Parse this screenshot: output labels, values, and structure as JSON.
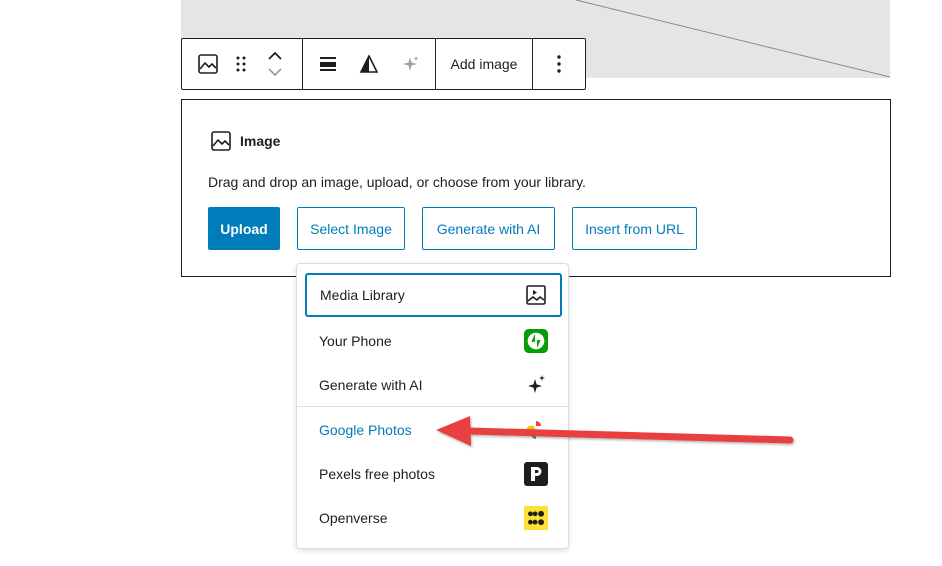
{
  "toolbar": {
    "add_image_label": "Add image",
    "icons": [
      "image-icon",
      "drag-handle-icon",
      "move-up-icon",
      "move-down-icon",
      "align-icon",
      "duotone-icon",
      "ai-sparkle-icon",
      "more-options-icon"
    ]
  },
  "placeholder": {
    "title": "Image",
    "instructions": "Drag and drop an image, upload, or choose from your library.",
    "buttons": {
      "upload": "Upload",
      "select_image": "Select Image",
      "generate_ai": "Generate with AI",
      "insert_url": "Insert from URL"
    }
  },
  "menu": {
    "items": [
      {
        "label": "Media Library",
        "icon": "media-library-icon"
      },
      {
        "label": "Your Phone",
        "icon": "jetpack-phone-icon"
      },
      {
        "label": "Generate with AI",
        "icon": "ai-sparkle-icon"
      },
      {
        "label": "Google Photos",
        "icon": "google-photos-icon"
      },
      {
        "label": "Pexels free photos",
        "icon": "pexels-icon"
      },
      {
        "label": "Openverse",
        "icon": "openverse-icon"
      }
    ]
  },
  "colors": {
    "accent": "#007cba",
    "annotation_arrow": "#e84040",
    "jetpack_green": "#069e08",
    "openverse_yellow": "#ffe033"
  }
}
